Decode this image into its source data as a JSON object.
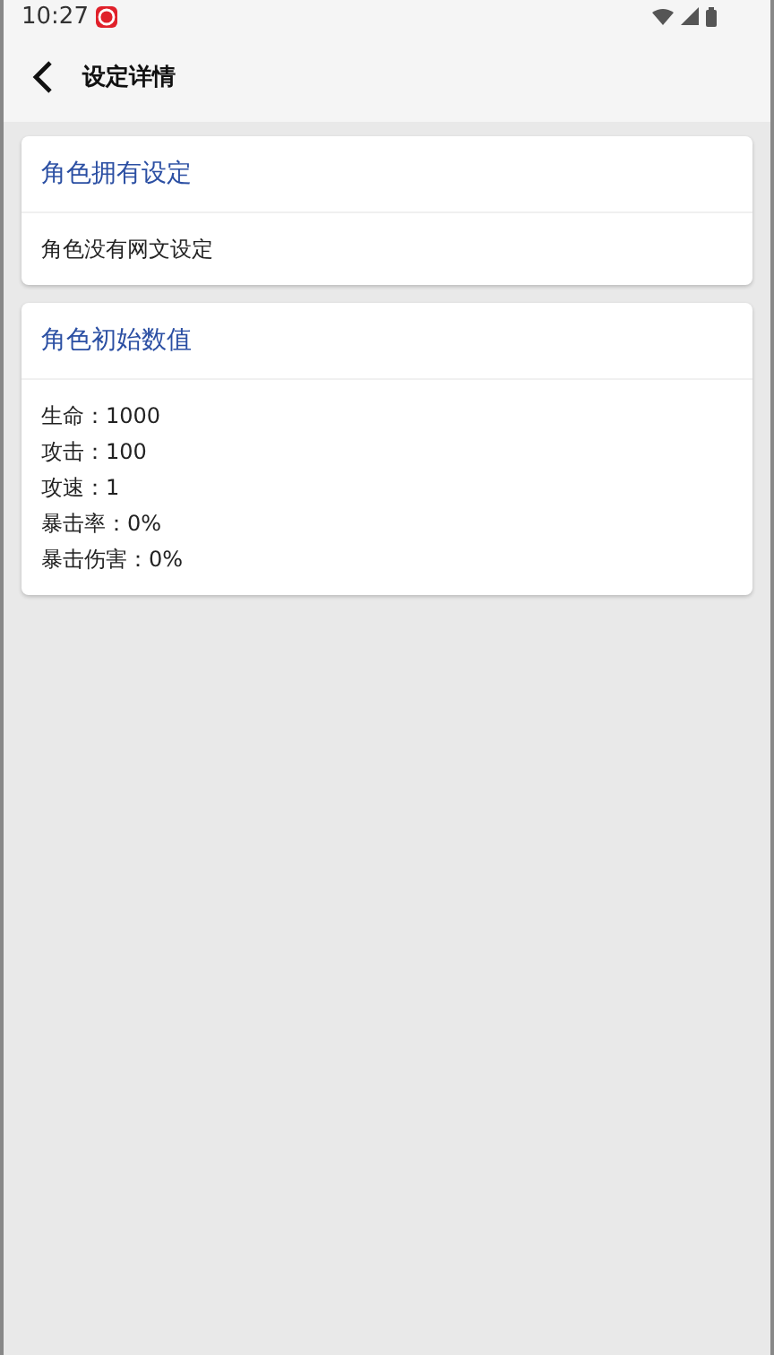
{
  "status_bar": {
    "time": "10:27"
  },
  "app_bar": {
    "title": "设定详情"
  },
  "cards": [
    {
      "title": "角色拥有设定",
      "lines": [
        "角色没有网文设定"
      ]
    },
    {
      "title": "角色初始数值",
      "lines": [
        "生命：1000",
        "攻击：100",
        "攻速：1",
        "暴击率：0%",
        "暴击伤害：0%"
      ]
    }
  ]
}
